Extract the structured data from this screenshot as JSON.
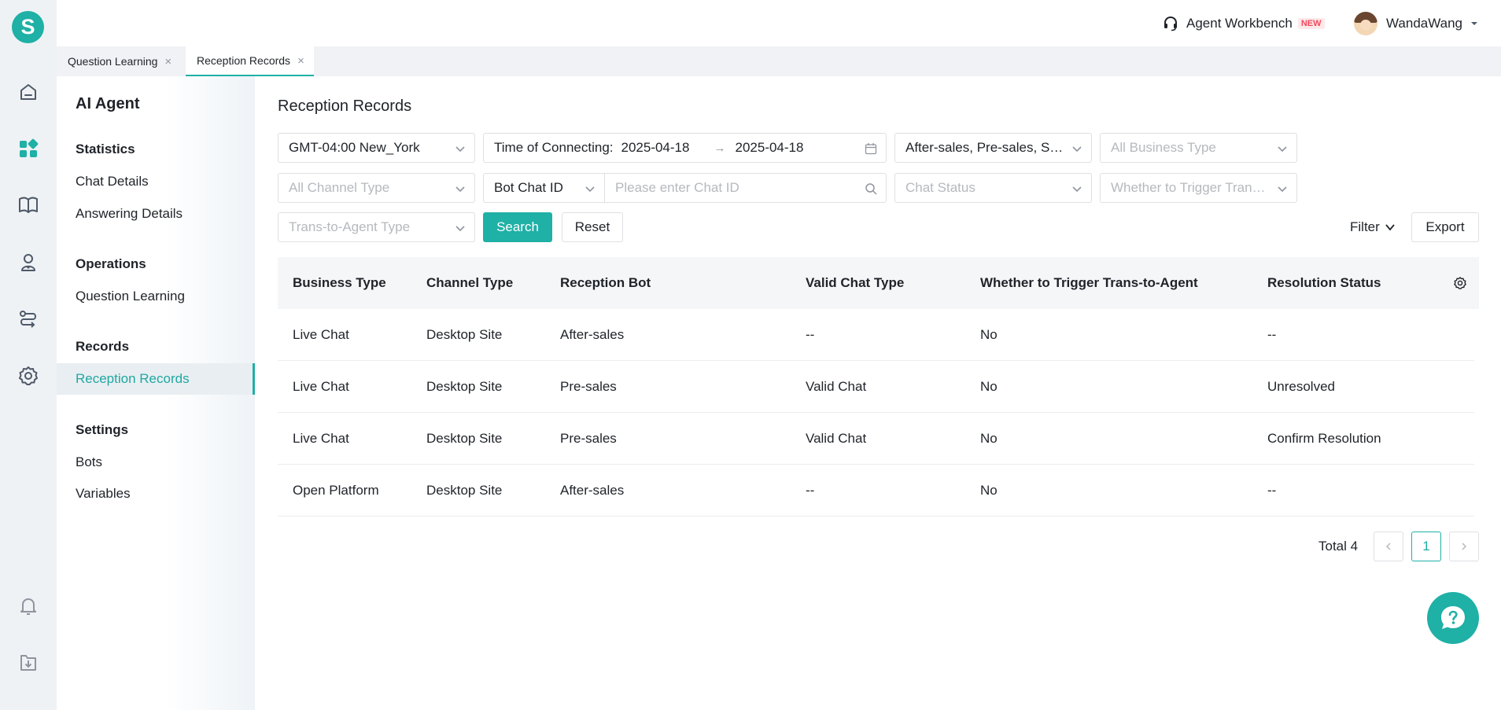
{
  "rail": {
    "logo": "S",
    "icons": [
      "home-icon",
      "apps-icon",
      "book-icon",
      "agent-icon",
      "route-icon",
      "gear-icon",
      "bell-icon",
      "download-icon"
    ]
  },
  "topbar": {
    "workbench_label": "Agent Workbench",
    "workbench_badge": "NEW",
    "user_name": "WandaWang"
  },
  "tabs": [
    {
      "label": "Question Learning",
      "close": "×"
    },
    {
      "label": "Reception Records",
      "close": "×"
    }
  ],
  "sidenav": {
    "title": "AI Agent",
    "groups": [
      {
        "label": "Statistics",
        "items": [
          "Chat Details",
          "Answering Details"
        ]
      },
      {
        "label": "Operations",
        "items": [
          "Question Learning"
        ]
      },
      {
        "label": "Records",
        "items": [
          "Reception Records"
        ]
      },
      {
        "label": "Settings",
        "items": [
          "Bots",
          "Variables"
        ]
      }
    ]
  },
  "page": {
    "title": "Reception Records"
  },
  "filters": {
    "timezone": "GMT-04:00 New_York",
    "time_label": "Time of Connecting:",
    "date_from": "2025-04-18",
    "date_sep": "→",
    "date_to": "2025-04-18",
    "reception_bot": "After-sales, Pre-sales, Spa...",
    "business_type_ph": "All Business Type",
    "channel_type_ph": "All Channel Type",
    "chat_id_type": "Bot Chat ID",
    "chat_id_ph": "Please enter Chat ID",
    "chat_status_ph": "Chat Status",
    "trigger_ph": "Whether to Trigger Trans...",
    "trans_type_ph": "Trans-to-Agent Type",
    "search_label": "Search",
    "reset_label": "Reset",
    "filter_label": "Filter",
    "export_label": "Export"
  },
  "table": {
    "columns": [
      "Business Type",
      "Channel Type",
      "Reception Bot",
      "Valid Chat Type",
      "Whether to Trigger Trans-to-Agent",
      "Resolution Status"
    ],
    "rows": [
      [
        "Live Chat",
        "Desktop Site",
        "After-sales",
        "--",
        "No",
        "--"
      ],
      [
        "Live Chat",
        "Desktop Site",
        "Pre-sales",
        "Valid Chat",
        "No",
        "Unresolved"
      ],
      [
        "Live Chat",
        "Desktop Site",
        "Pre-sales",
        "Valid Chat",
        "No",
        "Confirm Resolution"
      ],
      [
        "Open Platform",
        "Desktop Site",
        "After-sales",
        "--",
        "No",
        "--"
      ]
    ]
  },
  "pagination": {
    "total_label": "Total 4",
    "current_page": "1"
  },
  "colors": {
    "accent": "#1fb0a6",
    "rail_bg": "#eff2f5",
    "header_bg": "#f5f6f7"
  }
}
